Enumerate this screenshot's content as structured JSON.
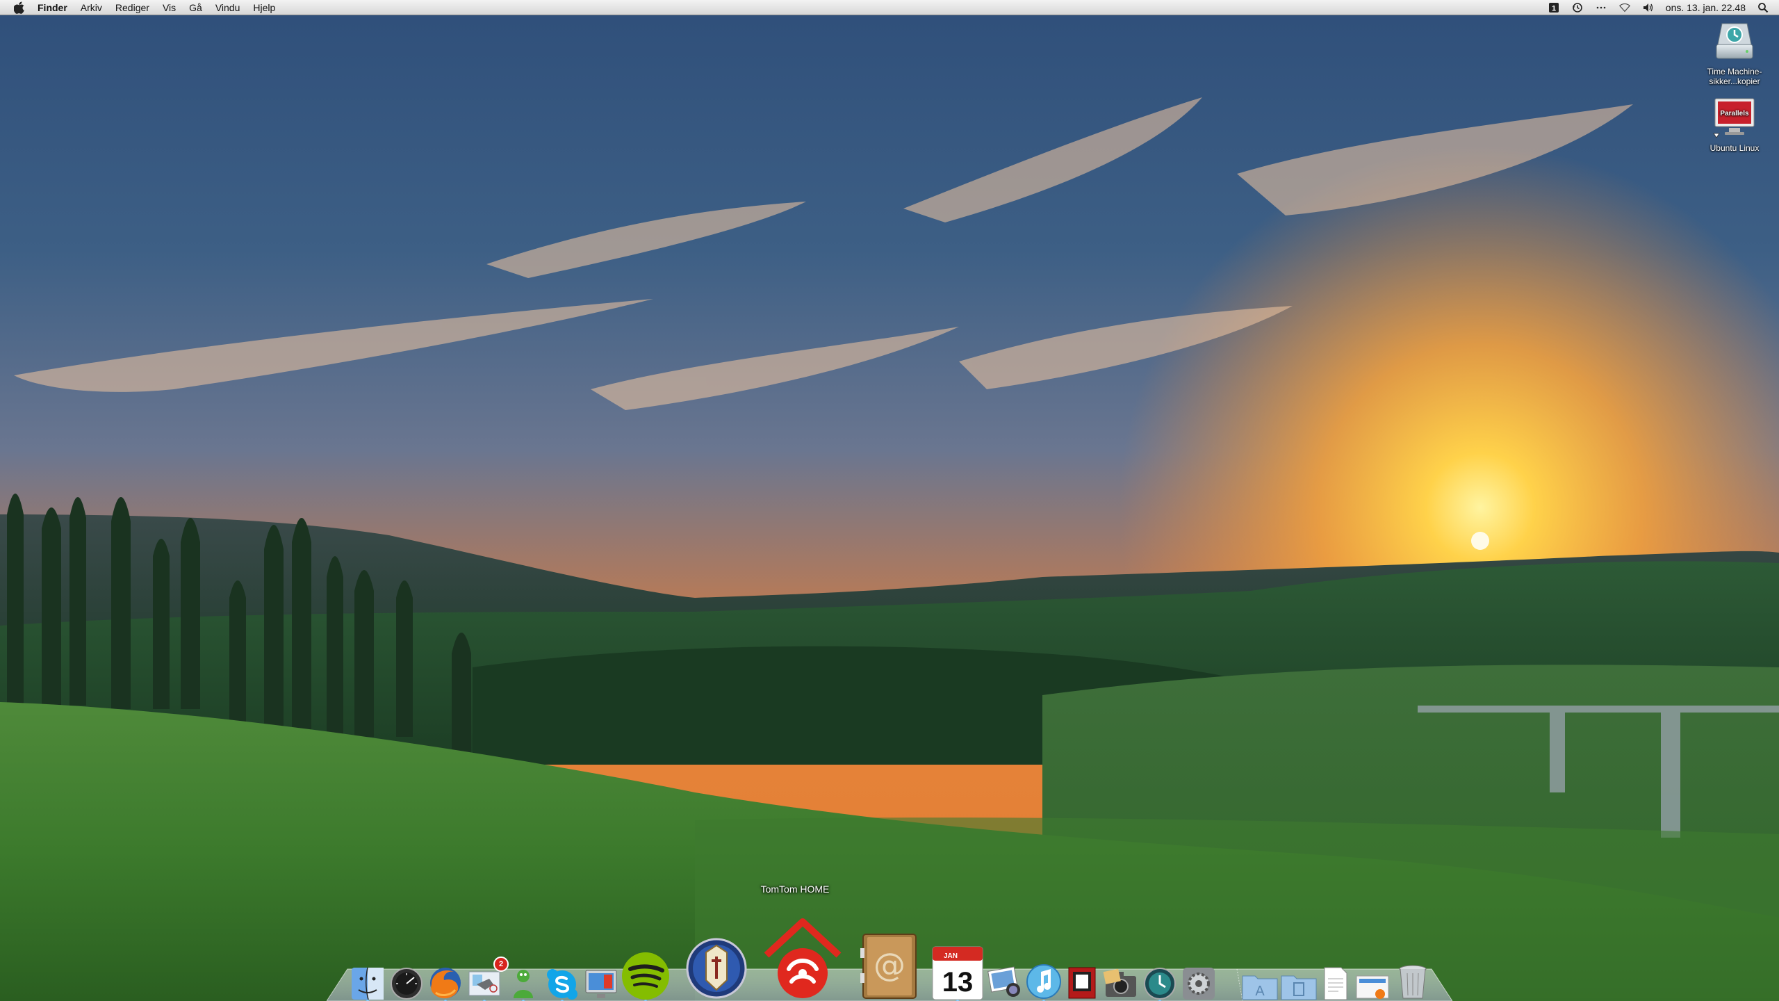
{
  "menubar": {
    "apple_icon": "apple-icon",
    "app_name": "Finder",
    "menus": [
      "Arkiv",
      "Rediger",
      "Vis",
      "Gå",
      "Vindu",
      "Hjelp"
    ],
    "clock": "ons. 13. jan.  22.48",
    "status_icons": [
      "input-source-icon",
      "time-machine-icon",
      "bluetooth-icon",
      "wifi-icon",
      "volume-icon",
      "spotlight-icon"
    ],
    "input_source_glyph": "1"
  },
  "desktop": {
    "icons": [
      {
        "label": "Time Machine-sikker...kopier",
        "icon": "time-machine-drive-icon"
      },
      {
        "label": "Ubuntu Linux",
        "icon": "parallels-vm-icon",
        "brand_text": "Parallels"
      }
    ]
  },
  "dock": {
    "tooltip": "TomTom HOME",
    "calendar_month": "JAN",
    "calendar_day": "13",
    "mail_badge": "2",
    "items": [
      "finder",
      "dashboard",
      "firefox",
      "mail",
      "adium",
      "skype",
      "photo-booth",
      "spotify",
      "age-of-empires",
      "tomtom-home",
      "address-book",
      "ical",
      "iphoto",
      "itunes",
      "photo-booth-2",
      "image-capture",
      "time-machine",
      "system-preferences",
      "applications-stack",
      "documents-stack",
      "text-document",
      "downloads-stack",
      "trash"
    ]
  }
}
